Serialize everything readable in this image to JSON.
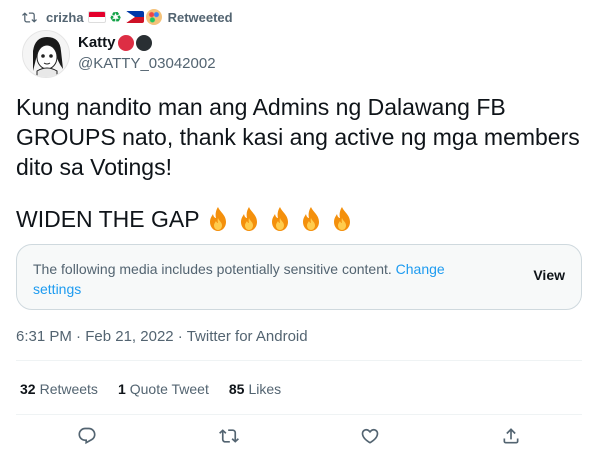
{
  "retweet": {
    "name": "crizha",
    "label": "Retweeted"
  },
  "author": {
    "display_name": "Katty",
    "handle": "@KATTY_03042002"
  },
  "tweet": {
    "text": "Kung nandito man ang Admins ng Dalawang FB GROUPS nato, thank kasi ang active ng mga members dito sa Votings!",
    "line2": "WIDEN THE GAP",
    "emoji_count": 5
  },
  "sensitive": {
    "message": "The following media includes potentially sensitive content.",
    "link": "Change settings",
    "view_label": "View"
  },
  "meta": {
    "time": "6:31 PM",
    "date": "Feb 21, 2022",
    "source": "Twitter for Android"
  },
  "stats": {
    "retweets_count": "32",
    "retweets_label": "Retweets",
    "quotes_count": "1",
    "quotes_label": "Quote Tweet",
    "likes_count": "85",
    "likes_label": "Likes"
  },
  "colors": {
    "link": "#1d9bf0",
    "secondary_text": "#536471",
    "primary_text": "#0f1419"
  }
}
